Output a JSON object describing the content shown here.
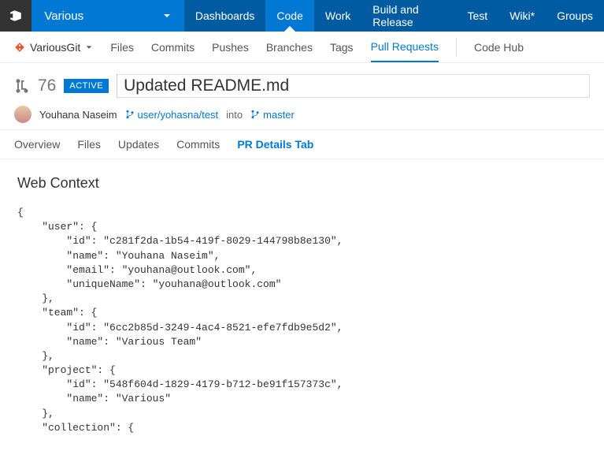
{
  "topnav": {
    "project": "Various",
    "tabs": [
      "Dashboards",
      "Code",
      "Work",
      "Build and Release",
      "Test",
      "Wiki*",
      "Groups"
    ],
    "active": "Code"
  },
  "subnav": {
    "repo": "VariousGit",
    "items": [
      "Files",
      "Commits",
      "Pushes",
      "Branches",
      "Tags",
      "Pull Requests"
    ],
    "active": "Pull Requests",
    "right": "Code Hub"
  },
  "pr": {
    "icon_label": "pull-request",
    "id": "76",
    "badge": "ACTIVE",
    "title": "Updated README.md",
    "author": "Youhana Naseim",
    "source_branch": "user/yohasna/test",
    "into": "into",
    "target_branch": "master"
  },
  "prtabs": {
    "items": [
      "Overview",
      "Files",
      "Updates",
      "Commits",
      "PR Details Tab"
    ],
    "active": "PR Details Tab"
  },
  "section": {
    "title": "Web Context"
  },
  "webcontext_text": "{\n    \"user\": {\n        \"id\": \"c281f2da-1b54-419f-8029-144798b8e130\",\n        \"name\": \"Youhana Naseim\",\n        \"email\": \"youhana@outlook.com\",\n        \"uniqueName\": \"youhana@outlook.com\"\n    },\n    \"team\": {\n        \"id\": \"6cc2b85d-3249-4ac4-8521-efe7fdb9e5d2\",\n        \"name\": \"Various Team\"\n    },\n    \"project\": {\n        \"id\": \"548f604d-1829-4179-b712-be91f157373c\",\n        \"name\": \"Various\"\n    },\n    \"collection\": {"
}
